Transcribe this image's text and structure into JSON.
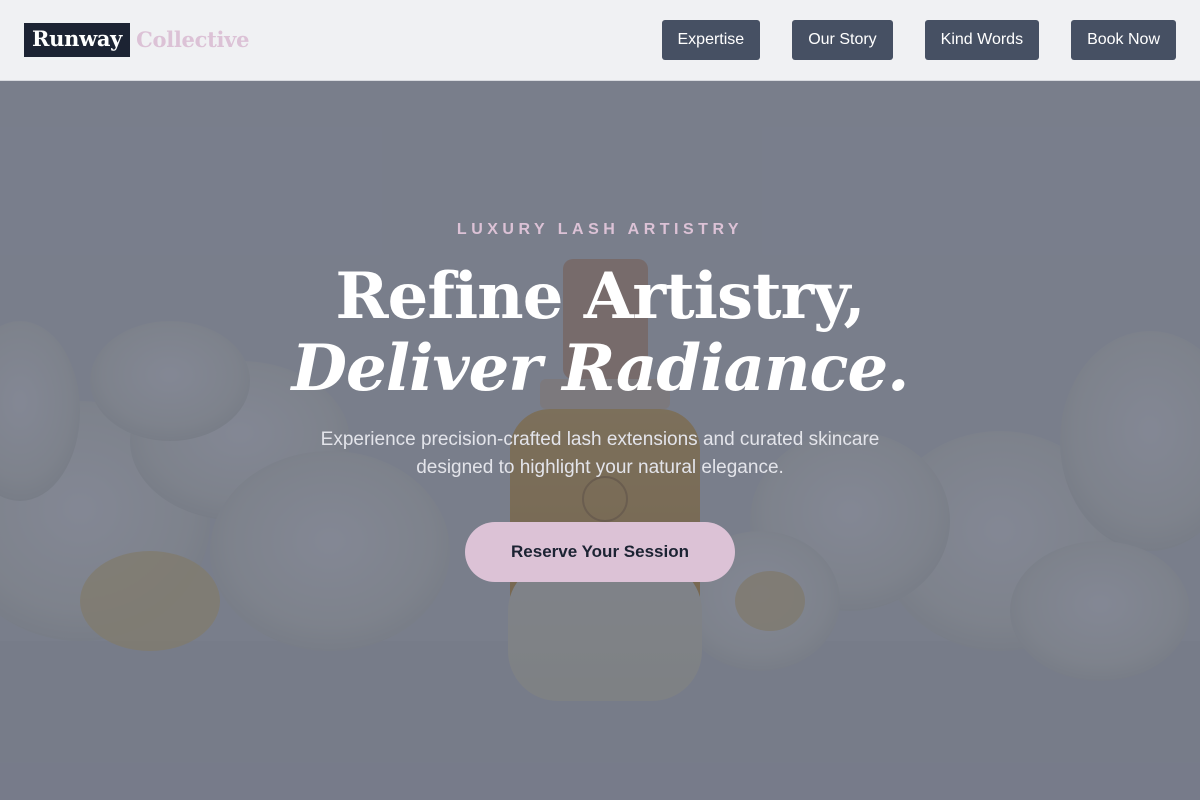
{
  "header": {
    "brand_main": "Runway",
    "brand_sub": "Collective",
    "nav": [
      {
        "label": "Expertise"
      },
      {
        "label": "Our Story"
      },
      {
        "label": "Kind Words"
      },
      {
        "label": "Book Now"
      }
    ]
  },
  "hero": {
    "eyebrow": "LUXURY LASH ARTISTRY",
    "headline_line1": "Refine Artistry,",
    "headline_line2": "Deliver Radiance.",
    "subtext": "Experience precision-crafted lash extensions and curated skincare designed to highlight your natural elegance.",
    "cta_label": "Reserve Your Session",
    "background_image": "serum-bottle-with-white-orchids"
  },
  "colors": {
    "brand_dark": "#1c2333",
    "accent_pink": "#dcc2d6",
    "nav_button": "#465063",
    "header_bg": "#f0f1f3",
    "overlay": "#484e62"
  }
}
